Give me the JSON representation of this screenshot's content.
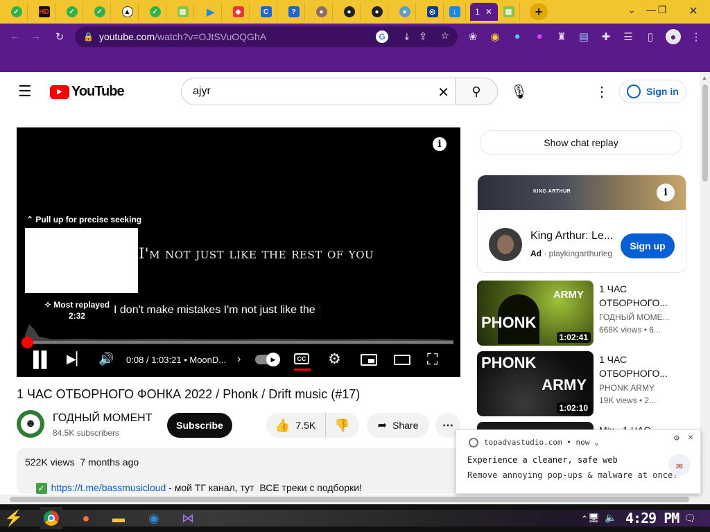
{
  "browser": {
    "active_tab_label": "1",
    "url_host": "youtube.com",
    "url_path": "/watch?v=OJtSVuOQGhA",
    "new_tab": "+"
  },
  "youtube": {
    "logo_text": "YouTube",
    "search_value": "ajyr",
    "signin_label": "Sign in"
  },
  "player": {
    "precise_seek_hint": "Pull up for precise seeking",
    "lyrics_line": "I'm not just like the rest of you",
    "caption_text": "I don't make mistakes I'm not just like the",
    "most_replayed_label": "Most replayed",
    "most_replayed_time": "2:32",
    "time_current": "0:08",
    "time_total": "1:03:21",
    "chapter_label": "MoonD...",
    "time_sep": "/",
    "chapter_sep": "•",
    "progress": 0.002
  },
  "video": {
    "title": "1 ЧАС ОТБОРНОГО ФОНКА 2022 / Phonk / Drift music (#17)",
    "channel_name": "ГОДНЫЙ МОМЕНТ",
    "subscribers": "84.5K subscribers",
    "subscribe_label": "Subscribe",
    "likes": "7.5K",
    "share_label": "Share",
    "views_date": "522K views  7 months ago",
    "desc_link": "https://t.me/bassmusicloud",
    "desc_rest": " - мой ТГ канал, тут  ВСЕ треки с подборки!"
  },
  "sidebar": {
    "chat_replay_label": "Show chat replay",
    "ad": {
      "title": "King Arthur: Le...",
      "badge": "Ad",
      "domain": "playkingarthurleg",
      "signup_label": "Sign up",
      "banner_text": "KING ARTHUR"
    },
    "recommendations": [
      {
        "title": "1 ЧАС ОТБОРНОГО...",
        "channel": "ГОДНЫЙ МОМЕ...",
        "meta": "668K views • 6...",
        "duration": "1:02:41",
        "thumb_text_1": "ARMY",
        "thumb_text_2": "PHONK"
      },
      {
        "title": "1 ЧАС ОТБОРНОГО...",
        "channel": "PHONK ARMY",
        "meta": "19K views • 2...",
        "duration": "1:02:10",
        "thumb_text_1": "PHONK",
        "thumb_text_2": "ARMY"
      },
      {
        "title": "Mix - 1 ЧАС"
      }
    ]
  },
  "notification": {
    "site": "topadvastudio.com",
    "when": "now",
    "line1": "Experience a cleaner, safe web",
    "line2": "Remove annoying pop-ups & malware at once!"
  },
  "taskbar": {
    "clock": "4:29 PM"
  },
  "colors": {
    "tab_strip": "#f2c52e",
    "toolbar": "#5a1a8a",
    "yt_red": "#ff0000",
    "subscribe_bg": "#0f0f0f",
    "signup_bg": "#065fd4"
  }
}
